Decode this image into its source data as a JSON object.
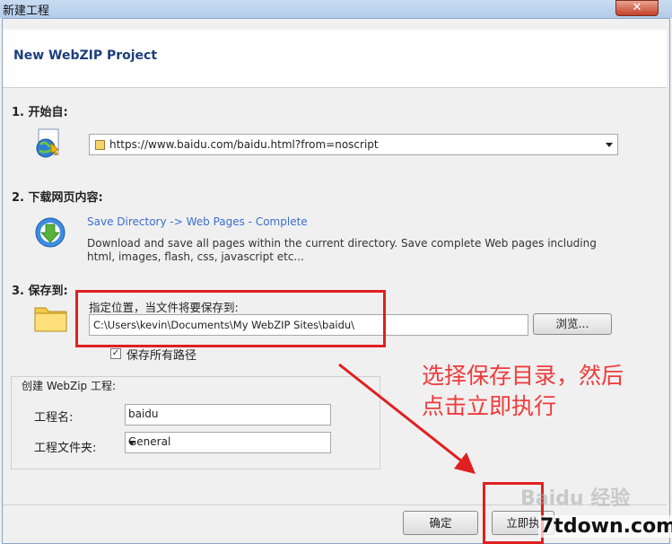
{
  "window": {
    "title": "新建工程",
    "close_label": "✕"
  },
  "header": {
    "title": "New WebZIP Project"
  },
  "section1": {
    "label": "1. 开始自:",
    "url": "https://www.baidu.com/baidu.html?from=noscript"
  },
  "section2": {
    "label": "2. 下载网页内容:",
    "option_link": "Save Directory -> Web Pages - Complete",
    "description": "Download and save all pages within the current directory. Save complete Web pages including html, images, flash, css, javascript etc..."
  },
  "section3": {
    "label": "3. 保存到:",
    "location_label": "指定位置，当文件将要保存到:",
    "path": "C:\\Users\\kevin\\Documents\\My WebZIP Sites\\baidu\\",
    "browse_label": "浏览...",
    "save_paths_label": "保存所有路径",
    "save_paths_checked": true
  },
  "project": {
    "group_title": "创建 WebZip 工程:",
    "name_label": "工程名:",
    "name_value": "baidu",
    "folder_label": "工程文件夹:",
    "folder_value": "General"
  },
  "annotation": {
    "line1": "选择保存目录，然后",
    "line2": "点击立即执行"
  },
  "footer": {
    "ok_label": "确定",
    "run_label": "立即执"
  },
  "watermark": {
    "text": "Baidu 经验",
    "site": "7tdown.com"
  }
}
